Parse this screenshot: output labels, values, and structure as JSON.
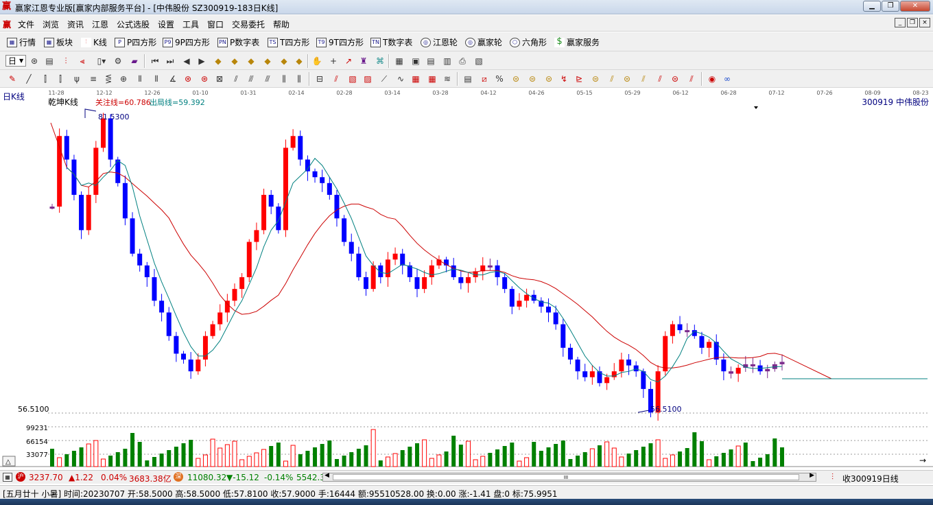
{
  "window": {
    "title": "赢家江恩专业版[赢家内部服务平台] - [中伟股份  SZ300919-183日K线]",
    "logo": "赢",
    "min": "▁",
    "max": "❐",
    "close": "✕"
  },
  "menu": {
    "logo": "赢",
    "items": [
      "文件",
      "浏览",
      "资讯",
      "江恩",
      "公式选股",
      "设置",
      "工具",
      "窗口",
      "交易委托",
      "帮助"
    ]
  },
  "toolbar1": [
    {
      "label": "行情",
      "icon": "grid-icon"
    },
    {
      "label": "板块",
      "icon": "blocks-icon"
    },
    {
      "label": "K线",
      "icon": "kline-icon"
    },
    {
      "label": "P四方形",
      "icon": "P"
    },
    {
      "label": "9P四方形",
      "icon": "P9"
    },
    {
      "label": "P数字表",
      "icon": "PN"
    },
    {
      "label": "T四方形",
      "icon": "TS"
    },
    {
      "label": "9T四方形",
      "icon": "T9"
    },
    {
      "label": "T数字表",
      "icon": "TN"
    },
    {
      "label": "江恩轮",
      "icon": "wheel-icon"
    },
    {
      "label": "赢家轮",
      "icon": "wheel2-icon"
    },
    {
      "label": "六角形",
      "icon": "hexagon-icon"
    },
    {
      "label": "赢家服务",
      "icon": "dollar-icon"
    }
  ],
  "toolbar2": {
    "period": "日"
  },
  "chart": {
    "period_label": "日K线",
    "indicator_name": "乾坤K线",
    "focus_line_label": "关注线=60.786",
    "exit_line_label": "出局线=59.392",
    "stock_label": "300919  中伟股份",
    "high_label": "81.5300",
    "low_label": "56.5100",
    "y_low_label": "56.5100",
    "vol_labels": [
      "99231",
      "66154",
      "33077"
    ],
    "dates": [
      "11-28",
      "12-12",
      "12-26",
      "01-10",
      "01-31",
      "02-14",
      "02-28",
      "03-14",
      "03-28",
      "04-12",
      "04-26",
      "05-15",
      "05-29",
      "06-12",
      "06-28",
      "07-12",
      "07-26",
      "08-09",
      "08-23"
    ],
    "colors": {
      "up": "#ff0000",
      "down": "#0000ff",
      "hold": "#7b2a8c",
      "ma_fast": "#008080",
      "ma_slow": "#cc0000",
      "vol_up": "#ff0000",
      "vol_down": "#008000",
      "label": "#00007f"
    }
  },
  "chart_data": {
    "type": "candlestick",
    "ohlc_approx_path_y": [
      74,
      80,
      78,
      75,
      72,
      75,
      79,
      81.5,
      78,
      76,
      73,
      70,
      69,
      68,
      66,
      65,
      63,
      61.5,
      61,
      60,
      61,
      63,
      64,
      65,
      66,
      67,
      68,
      71,
      72,
      75,
      74,
      72,
      79,
      80,
      78,
      77,
      76.5,
      76,
      75,
      73,
      71,
      70,
      68,
      67,
      69,
      68,
      69.5,
      70,
      69,
      68,
      67,
      68,
      69,
      69.5,
      69,
      68,
      67.5,
      68,
      68.5,
      69,
      69,
      68,
      67,
      65.5,
      66,
      66.5,
      66,
      65.5,
      65,
      64,
      62,
      61,
      60,
      59.5,
      60,
      59,
      59.5,
      60,
      61,
      60.5,
      60,
      58.5,
      56.5,
      60,
      63,
      64,
      63.5,
      63.5,
      63,
      62,
      62.5,
      61,
      60,
      59.8,
      60.3,
      60.6,
      60.5,
      60,
      60.2,
      60.6,
      60.8
    ]
  },
  "bottom": {
    "sh_index": "3237.70",
    "sh_change": "▲1.22",
    "sh_pct": "0.04%",
    "sh_amount": "3683.38亿",
    "sz_index": "11080.32",
    "sz_change": "▼-15.12",
    "sz_pct": "-0.14%",
    "sz_amount": "5542.3",
    "right_label": "收300919日线",
    "scroll_mark": "III"
  },
  "status": {
    "text": "[五月廿十 小暑] 时间:20230707 开:58.5000 高:58.5000 低:57.8100 收:57.9000 手:16444 额:95510528.00 换:0.00 涨:-1.41 盘:0 标:75.9951"
  }
}
